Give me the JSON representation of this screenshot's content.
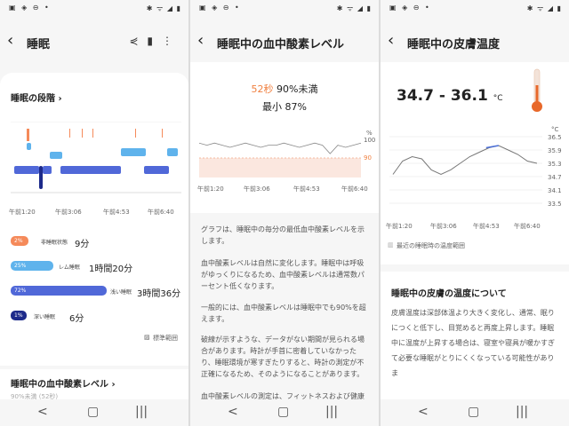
{
  "status_bar": {
    "left_icons": "▣ ◈ ⊖ •",
    "right_icons": "✱ ᯤ ◢ ▮"
  },
  "nav_bar": {
    "recent": "<",
    "home": "▢",
    "back": "|||"
  },
  "panel1": {
    "title": "睡眠",
    "stages_heading": "睡眠の段階",
    "x_ticks": [
      "午前1:20",
      "午前3:06",
      "午前4:53",
      "午前6:40"
    ],
    "stages": [
      {
        "percent": "2%",
        "label": "非睡眠状態",
        "duration": "9分",
        "color": "#f58a5a",
        "fraction": 0.02
      },
      {
        "percent": "25%",
        "label": "レム睡眠",
        "duration": "1時間20分",
        "color": "#5fb3ec",
        "fraction": 0.25
      },
      {
        "percent": "72%",
        "label": "浅い睡眠",
        "duration": "3時間36分",
        "color": "#5068d8",
        "fraction": 0.72
      },
      {
        "percent": "1%",
        "label": "深い睡眠",
        "duration": "6分",
        "color": "#1d2a8a",
        "fraction": 0.01
      }
    ],
    "legend_label": "標準範囲",
    "spo2_heading": "睡眠中の血中酸素レベル",
    "spo2_partial": "90%未満 (52秒)"
  },
  "panel2": {
    "title": "睡眠中の血中酸素レベル",
    "summary_time": "52秒",
    "summary_suffix": "90%未満",
    "summary_min": "最小 87%",
    "y_unit": "%",
    "y_ticks": [
      "100",
      "90"
    ],
    "x_ticks": [
      "午前1:20",
      "午前3:06",
      "午前4:53",
      "午前6:40"
    ],
    "paragraphs": [
      "グラフは、睡眠中の毎分の最低血中酸素レベルを示します。",
      "血中酸素レベルは自然に変化します。睡眠中は呼吸がゆっくりになるため、血中酸素レベルは通常数パーセント低くなります。",
      "一般的には、血中酸素レベルは睡眠中でも90%を超えます。",
      "破線が示すような、データがない期間が見られる場合があります。時計が手首に密着していなかったり、睡眠環境が寒すぎたりすると、時計の測定が不正確になるため、そのようになることがあります。",
      "血中酸素レベルの測定は、フィットネスおよび健康"
    ]
  },
  "panel3": {
    "title": "睡眠中の皮膚温度",
    "range_value": "34.7 - 36.1",
    "unit": "°C",
    "y_unit": "°C",
    "y_ticks": [
      "36.5",
      "35.9",
      "35.3",
      "34.7",
      "34.1",
      "33.5"
    ],
    "x_ticks": [
      "午前1:20",
      "午前3:06",
      "午前4:53",
      "午前6:40"
    ],
    "legend_label": "最近の睡眠時の温度範囲",
    "section_heading": "睡眠中の皮膚の温度について",
    "paragraph": "皮膚温度は深部体温より大きく変化し、通常、眠りにつくと低下し、目覚めると再度上昇します。睡眠中に温度が上昇する場合は、寝室や寝具が暖かすぎて必要な睡眠がとりにくくなっている可能性がありま"
  },
  "chart_data": [
    {
      "type": "line",
      "title": "睡眠中の血中酸素レベル",
      "x": [
        "午前1:20",
        "午前3:06",
        "午前4:53",
        "午前6:40"
      ],
      "y_ticks": [
        100,
        90
      ],
      "series": [
        {
          "values": [
            97,
            96,
            97,
            96,
            95,
            96,
            97,
            96,
            95,
            96,
            96,
            97,
            96,
            95,
            96,
            97,
            96,
            92,
            96,
            95,
            96,
            97
          ]
        }
      ]
    },
    {
      "type": "line",
      "title": "睡眠中の皮膚温度",
      "x": [
        "午前1:20",
        "午前3:06",
        "午前4:53",
        "午前6:40"
      ],
      "ylim": [
        33.5,
        36.5
      ],
      "series": [
        {
          "values": [
            34.8,
            35.4,
            35.6,
            35.5,
            35.0,
            34.8,
            35.0,
            35.3,
            35.6,
            35.8,
            36.0,
            36.1,
            35.9,
            35.7,
            35.4,
            35.3
          ]
        }
      ]
    }
  ]
}
